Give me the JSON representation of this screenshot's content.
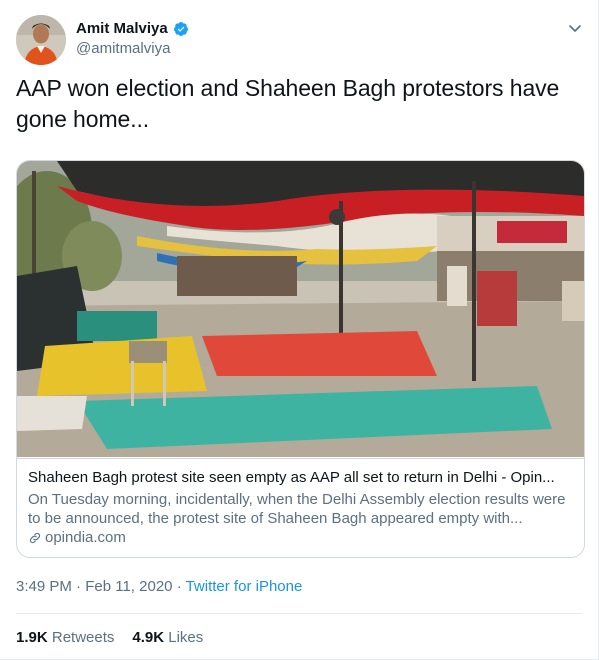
{
  "author": {
    "name": "Amit Malviya",
    "handle": "@amitmalviya"
  },
  "tweet": {
    "text": "AAP won election and Shaheen Bagh protestors have gone home..."
  },
  "card": {
    "title": "Shaheen Bagh protest site seen empty as AAP all set to return in Delhi - Opin...",
    "description": "On Tuesday morning, incidentally, when the Delhi Assembly election results were to be announced, the protest site of Shaheen Bagh appeared empty with...",
    "domain": "opindia.com"
  },
  "meta": {
    "time": "3:49 PM",
    "separator": "·",
    "date": "Feb 11, 2020",
    "source": "Twitter for iPhone"
  },
  "stats": {
    "retweets_count": "1.9K",
    "retweets_label": "Retweets",
    "likes_count": "4.9K",
    "likes_label": "Likes"
  },
  "colors": {
    "link_blue": "#1b95e0",
    "secondary_text": "#5b7083",
    "border": "#cfd9de"
  },
  "icons": {
    "verified": "verified-badge-icon",
    "caret": "chevron-down-icon",
    "link": "link-icon"
  }
}
